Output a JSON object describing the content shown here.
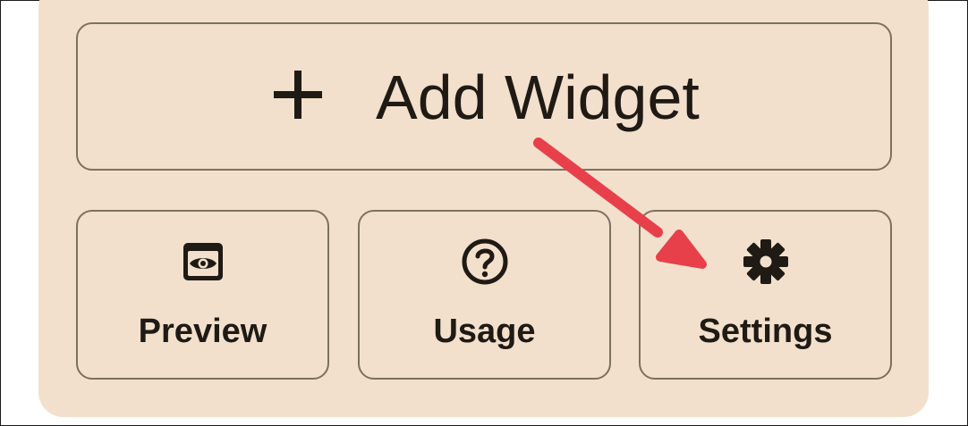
{
  "widget_menu": {
    "add_widget": {
      "label": "Add Widget",
      "icon": "plus-icon"
    },
    "actions": [
      {
        "label": "Preview",
        "icon": "preview-eye-icon"
      },
      {
        "label": "Usage",
        "icon": "help-circle-icon"
      },
      {
        "label": "Settings",
        "icon": "gear-icon"
      }
    ]
  },
  "annotation": {
    "icon": "red-arrow-pointing-to-settings",
    "color": "#e8404a"
  },
  "colors": {
    "panel_background": "#f2e0cd",
    "button_border": "#7d705f",
    "text": "#1f1a14"
  }
}
